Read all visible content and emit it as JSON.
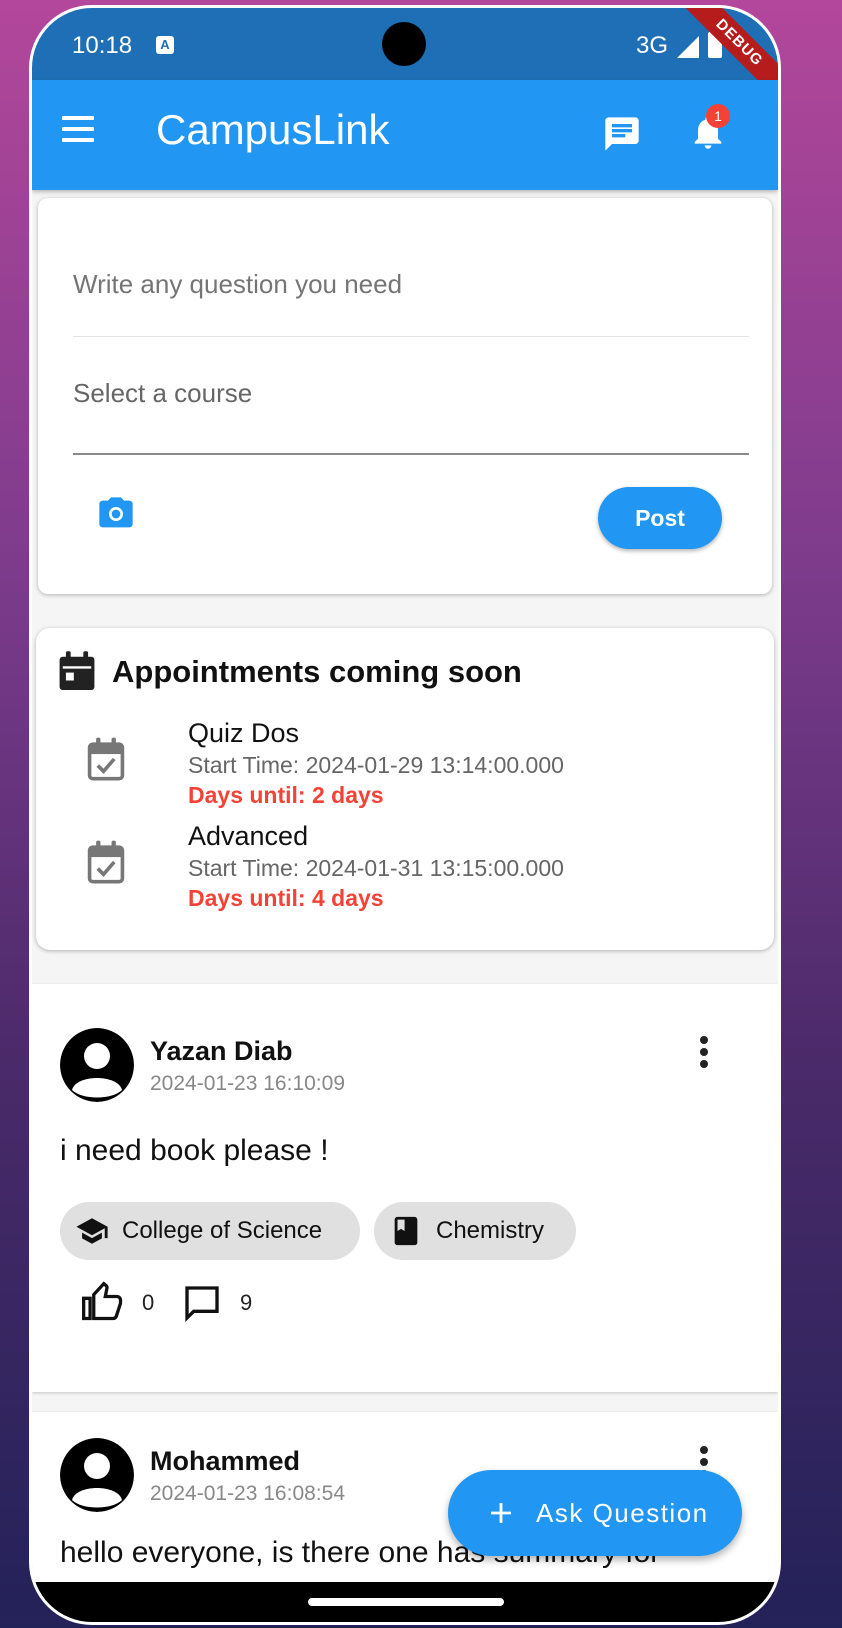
{
  "status_bar": {
    "time": "10:18",
    "network": "3G",
    "debug_banner": "DEBUG"
  },
  "app_bar": {
    "title": "CampusLink",
    "notification_count": "1",
    "colors": {
      "primary": "#2196f3",
      "status_bar": "#1f6fb6"
    }
  },
  "composer": {
    "question_placeholder": "Write any question you need",
    "course_placeholder": "Select a course",
    "post_label": "Post"
  },
  "appointments": {
    "title": "Appointments coming soon",
    "items": [
      {
        "name": "Quiz Dos",
        "start": "Start Time: 2024-01-29 13:14:00.000",
        "days": "Days until: 2 days"
      },
      {
        "name": "Advanced",
        "start": "Start Time: 2024-01-31 13:15:00.000",
        "days": "Days until: 4 days"
      }
    ]
  },
  "posts": [
    {
      "author": "Yazan Diab",
      "time": "2024-01-23 16:10:09",
      "text": "i need book please !",
      "tags": [
        {
          "icon": "graduation-cap-icon",
          "label": "College of Science"
        },
        {
          "icon": "book-icon",
          "label": "Chemistry"
        }
      ],
      "likes": "0",
      "comments": "9"
    },
    {
      "author": "Mohammed",
      "time": "2024-01-23 16:08:54",
      "text": "hello everyone, is there one has summary for"
    }
  ],
  "fab": {
    "label": "Ask Question"
  }
}
